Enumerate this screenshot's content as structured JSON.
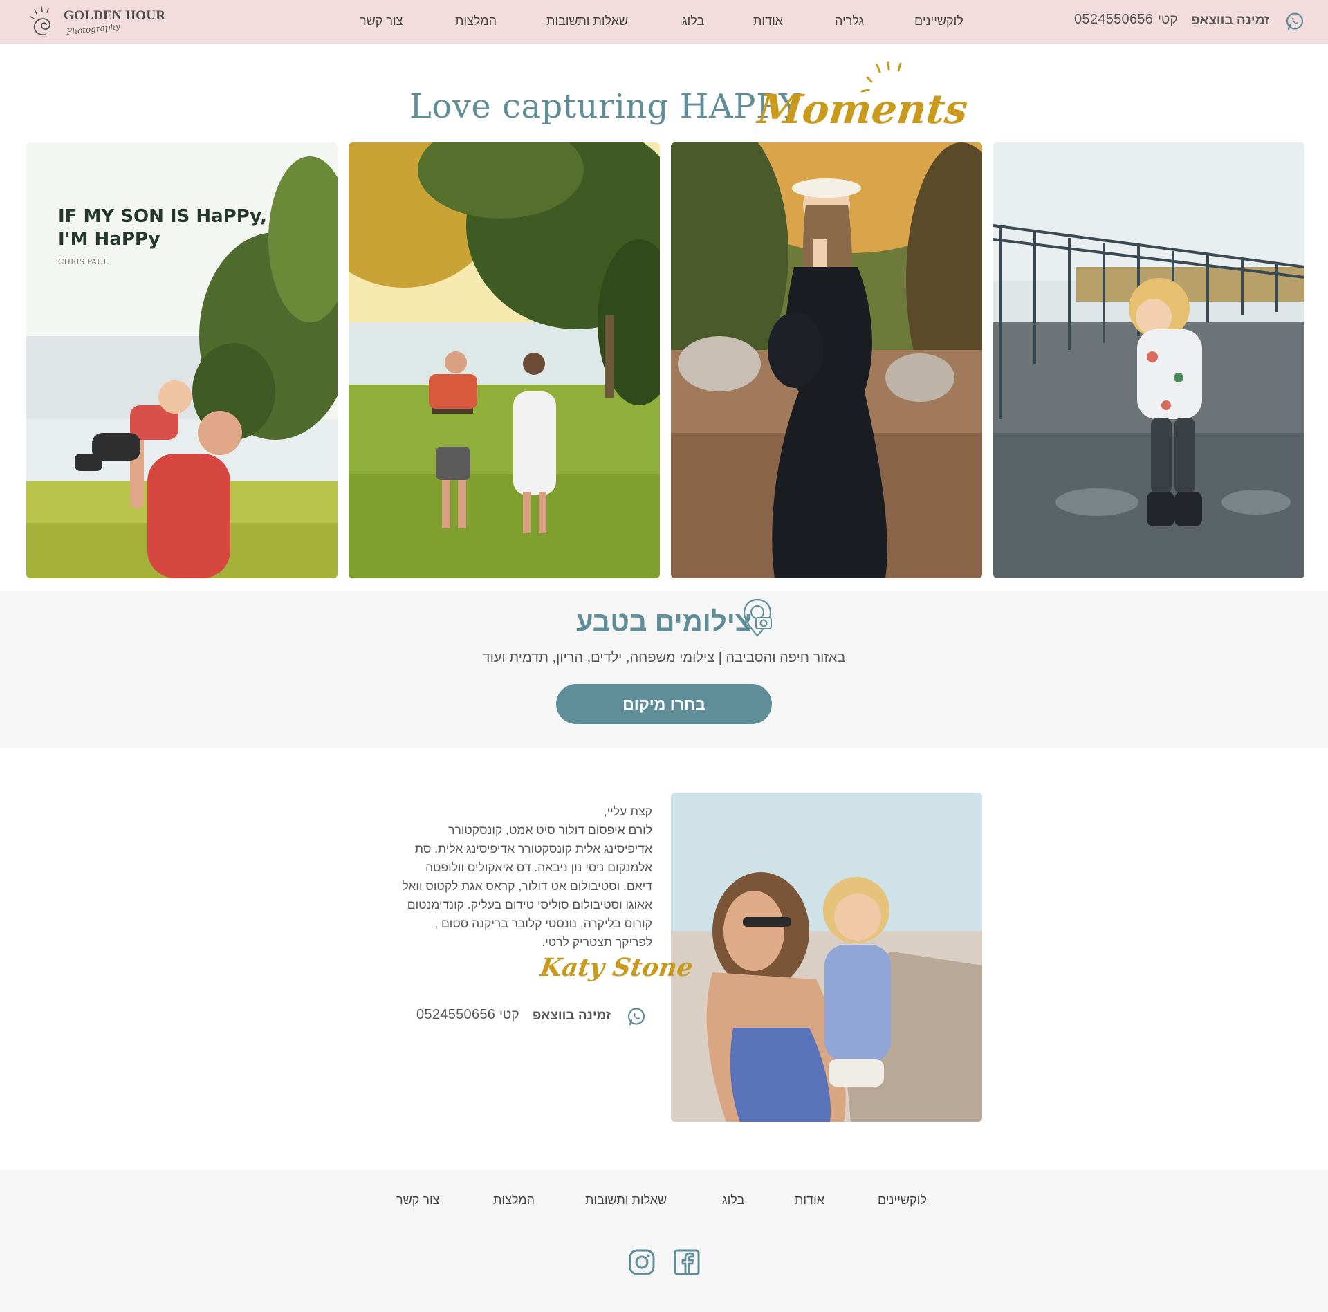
{
  "header": {
    "logo": {
      "title": "GOLDEN HOUR",
      "subtitle": "Photography"
    },
    "nav": [
      "לוקשיינים",
      "גלריה",
      "אודות",
      "בלוג",
      "שאלות ותשובות",
      "המלצות",
      "צור קשר"
    ],
    "whatsapp": {
      "label": "זמינה בווצאפ",
      "name": "קטי",
      "phone": "0524550656"
    }
  },
  "hero": {
    "title": "Love capturing HAPPY",
    "script_word": "Moments"
  },
  "gallery": {
    "quote_line1": "IF MY SON IS HaPPy,",
    "quote_line2": "I'M HaPPy",
    "quote_author": "CHRIS PAUL"
  },
  "locations": {
    "title": "צילומים בטבע",
    "subtitle": "באזור חיפה והסביבה  |  צילומי משפחה, ילדים, הריון, תדמית ועוד",
    "button": "בחרו מיקום"
  },
  "about": {
    "lines": [
      "קצת עליי,",
      "לורם איפסום דולור סיט אמט, קונסקטורר",
      "אדיפיסינג אלית קונסקטורר אדיפיסינג אלית. סת",
      "אלמנקום ניסי נון ניבאה. דס איאקוליס וולופטה",
      "דיאם. וסטיבולום אט דולור, קראס אגת לקטוס וואל",
      "אאוגו וסטיבולום סוליסי טידום בעליק. קונדימנטום",
      "קורוס בליקרה, נונסטי קלובר בריקנה סטום ,",
      "לפריקך תצטריק לרטי."
    ],
    "signature": "Katy Stone",
    "whatsapp": {
      "label": "זמינה בווצאפ",
      "name": "קטי",
      "phone": "0524550656"
    }
  },
  "footer": {
    "nav": [
      "לוקשיינים",
      "אודות",
      "בלוג",
      "שאלות ותשובות",
      "המלצות",
      "צור קשר"
    ]
  },
  "colors": {
    "teal": "#5f8e99",
    "gold": "#c99a1c",
    "header_bg": "#f2dcdd",
    "band_bg": "#f6f6f6"
  },
  "icons": [
    "whatsapp-icon",
    "location-camera-icon",
    "instagram-icon",
    "facebook-icon"
  ]
}
